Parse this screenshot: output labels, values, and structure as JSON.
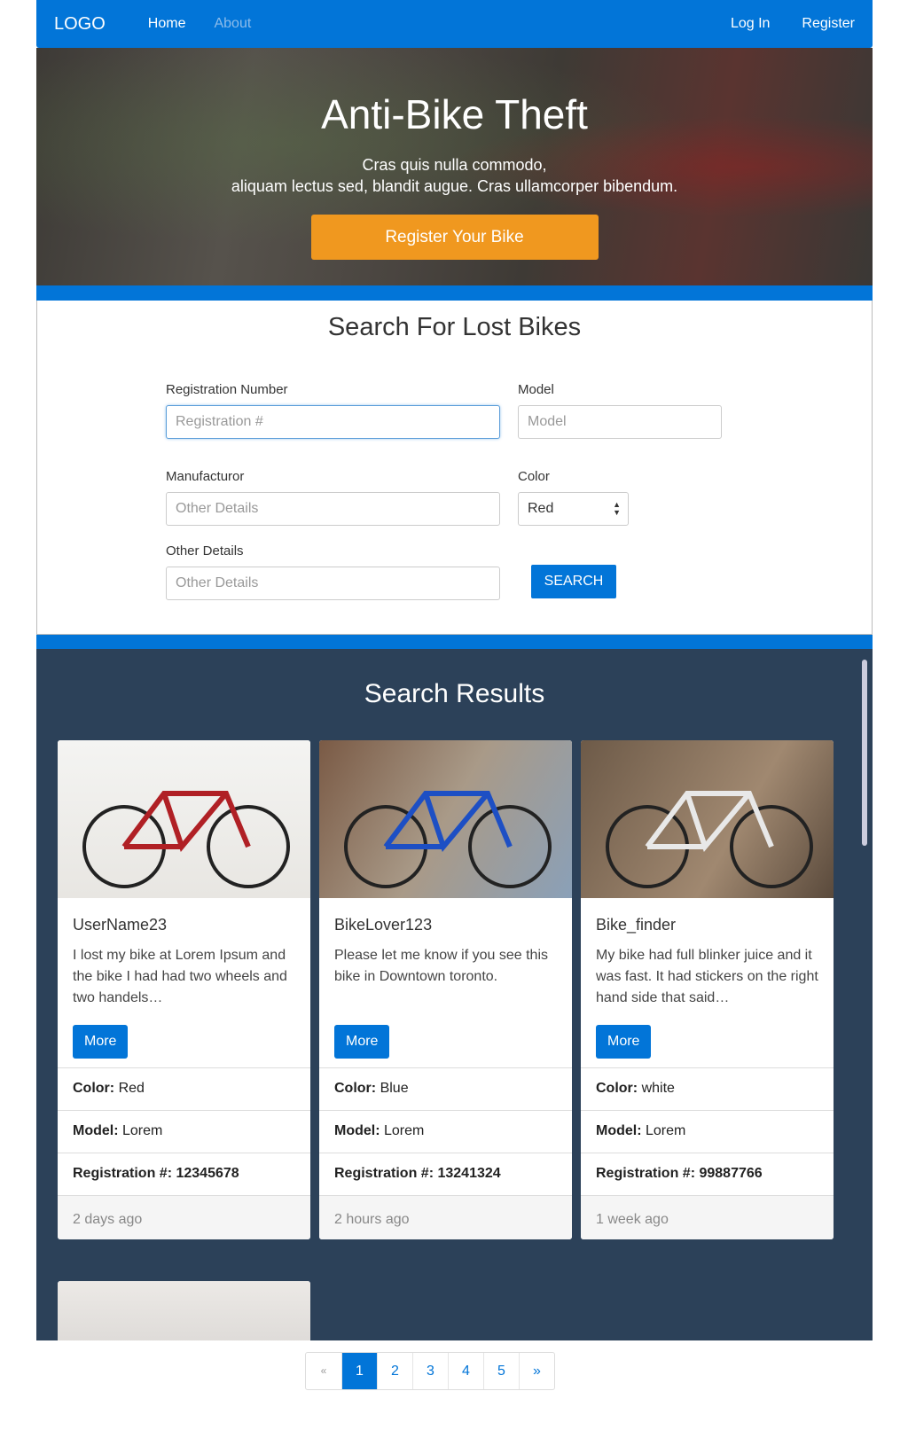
{
  "nav": {
    "logo": "LOGO",
    "home": "Home",
    "about": "About",
    "login": "Log In",
    "register": "Register"
  },
  "hero": {
    "title": "Anti-Bike Theft",
    "line1": "Cras quis nulla commodo,",
    "line2": "aliquam lectus sed, blandit augue. Cras ullamcorper bibendum.",
    "cta": "Register Your Bike"
  },
  "search": {
    "title": "Search For Lost Bikes",
    "reg_label": "Registration Number",
    "reg_placeholder": "Registration #",
    "model_label": "Model",
    "model_placeholder": "Model",
    "manu_label": "Manufacturor",
    "manu_placeholder": "Other Details",
    "color_label": "Color",
    "color_value": "Red",
    "other_label": "Other Details",
    "other_placeholder": "Other Details",
    "button": "SEARCH"
  },
  "results": {
    "title": "Search Results",
    "more_label": "More",
    "color_key": "Color:",
    "model_key": "Model:",
    "reg_key": "Registration #:",
    "cards": [
      {
        "user": "UserName23",
        "text": "I lost my bike at Lorem Ipsum and the bike I had had two wheels and two handels…",
        "color": "Red",
        "model": "Lorem",
        "reg": "12345678",
        "time": "2 days ago"
      },
      {
        "user": "BikeLover123",
        "text": "Please let me know if you see this bike in Downtown toronto.",
        "color": "Blue",
        "model": "Lorem",
        "reg": "13241324",
        "time": "2 hours ago"
      },
      {
        "user": "Bike_finder",
        "text": "My bike had full blinker juice and it was fast. It had stickers on the right hand side that said…",
        "color": "white",
        "model": "Lorem",
        "reg": "99887766",
        "time": "1 week ago"
      }
    ]
  },
  "pagination": {
    "prev": "«",
    "pages": [
      "1",
      "2",
      "3",
      "4",
      "5"
    ],
    "next": "»",
    "active": "1"
  },
  "colors": {
    "primary": "#0275d8",
    "accent": "#f0981f",
    "results_bg": "#2c4159"
  }
}
